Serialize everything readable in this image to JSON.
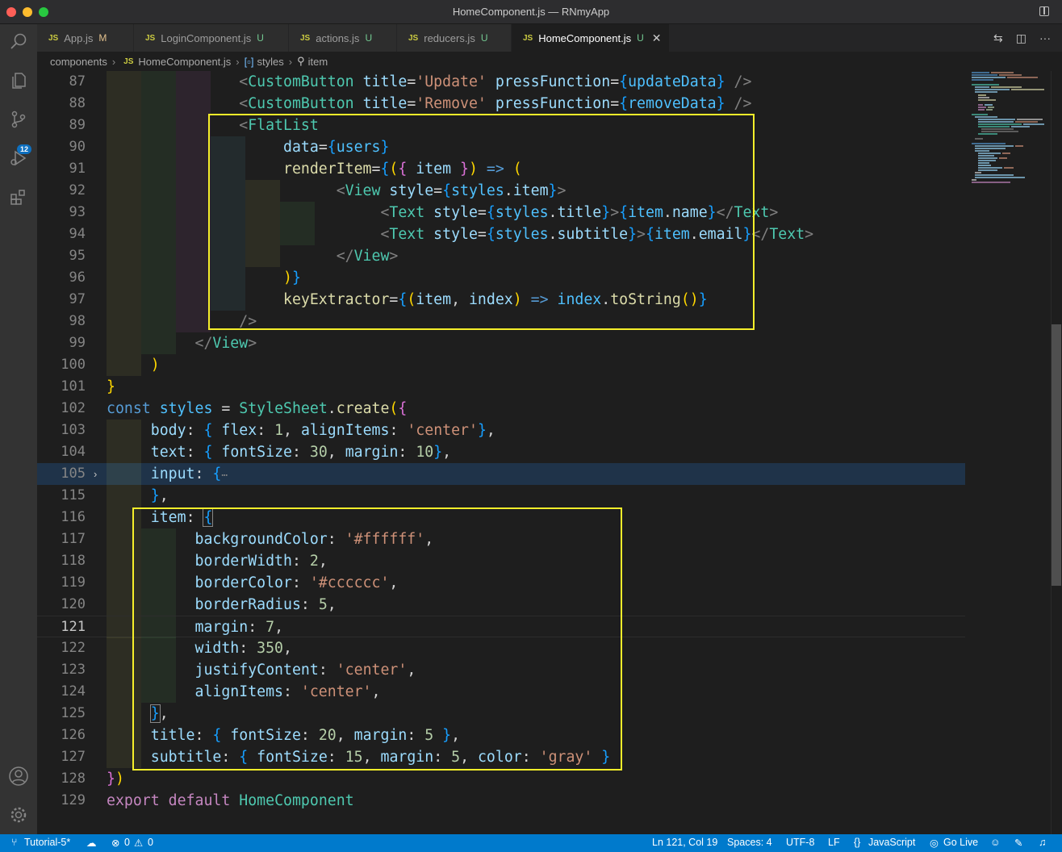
{
  "window": {
    "title": "HomeComponent.js — RNmyApp"
  },
  "activity": {
    "scm_badge": "12"
  },
  "tabs": [
    {
      "icon": "JS",
      "label": "App.js",
      "status": "M"
    },
    {
      "icon": "JS",
      "label": "LoginComponent.js",
      "status": "U"
    },
    {
      "icon": "JS",
      "label": "actions.js",
      "status": "U"
    },
    {
      "icon": "JS",
      "label": "reducers.js",
      "status": "U"
    },
    {
      "icon": "JS",
      "label": "HomeComponent.js",
      "status": "U",
      "close": "✕"
    }
  ],
  "breadcrumb": {
    "folder": "components",
    "file_icon": "JS",
    "file": "HomeComponent.js",
    "symbol1": "styles",
    "symbol2": "item"
  },
  "editor": {
    "line_numbers": [
      "87",
      "88",
      "89",
      "90",
      "91",
      "92",
      "93",
      "94",
      "95",
      "96",
      "97",
      "98",
      "99",
      "100",
      "101",
      "102",
      "103",
      "104",
      "105",
      "115",
      "116",
      "117",
      "118",
      "119",
      "120",
      "121",
      "122",
      "123",
      "124",
      "125",
      "126",
      "127",
      "128",
      "129"
    ],
    "active_line": "121",
    "folded_ellipsis": "⋯"
  },
  "colors": {
    "highlight_box": "#f5ee2a",
    "status_bar": "#007acc",
    "editor_bg": "#1e1e1e"
  },
  "status": {
    "branch": "Tutorial-5*",
    "errors": "0",
    "warnings": "0",
    "position": "Ln 121, Col 19",
    "spaces": "Spaces: 4",
    "encoding": "UTF-8",
    "eol": "LF",
    "language": "JavaScript",
    "golive": "Go Live"
  }
}
